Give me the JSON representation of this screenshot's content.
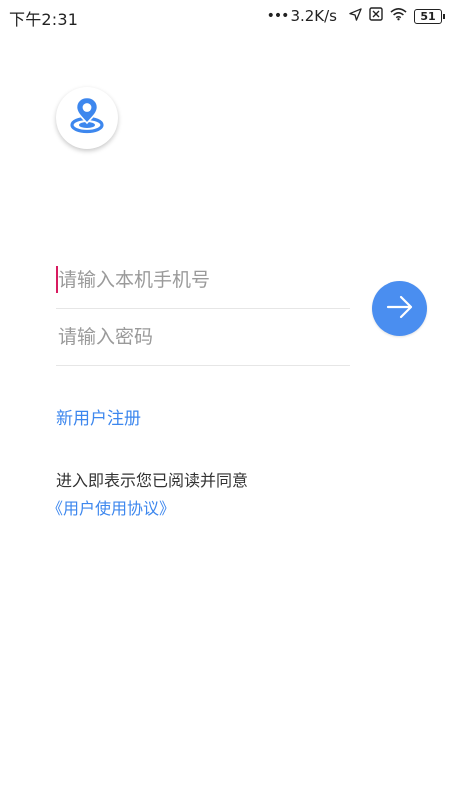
{
  "status_bar": {
    "time": "下午2:31",
    "dots": "•••",
    "network_speed": "3.2K/s",
    "battery_level": "51"
  },
  "login_form": {
    "phone_placeholder": "请输入本机手机号",
    "phone_value": "",
    "password_placeholder": "请输入密码",
    "password_value": ""
  },
  "links": {
    "register_label": "新用户注册",
    "agreement_notice": "进入即表示您已阅读并同意",
    "agreement_link": "《用户使用协议》"
  },
  "colors": {
    "accent": "#4a8ef0",
    "link": "#3d87ee",
    "cursor": "#d81b60"
  },
  "icons": {
    "logo": "location-pin-icon",
    "submit": "arrow-right-icon"
  }
}
